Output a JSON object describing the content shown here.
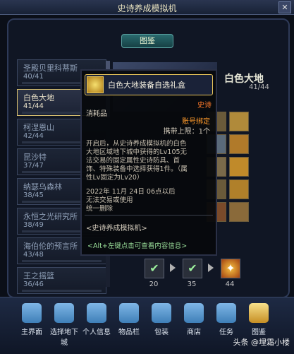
{
  "window": {
    "title": "史诗养成模拟机"
  },
  "tab": {
    "label": "图鉴"
  },
  "list": {
    "items": [
      {
        "name": "圣殿贝里科蒂斯",
        "count": "40/41"
      },
      {
        "name": "白色大地",
        "count": "41/44",
        "selected": true
      },
      {
        "name": "柯涅恩山",
        "count": "42/44"
      },
      {
        "name": "昆沙特",
        "count": "37/47"
      },
      {
        "name": "纳瑟乌森林",
        "count": "38/45"
      },
      {
        "name": "永恒之光研究所",
        "count": "38/49"
      },
      {
        "name": "海伯伦的预言所",
        "count": "43/48"
      },
      {
        "name": "王之摇篮",
        "count": "36/46"
      }
    ]
  },
  "detail": {
    "title": "白色大地",
    "count": "41/44"
  },
  "tooltip": {
    "name": "白色大地装备自选礼盒",
    "grade": "史诗",
    "type": "消耗品",
    "bind": "账号绑定",
    "limit": "携带上限：1个",
    "description": "开启后，从史诗养成模拟机的白色大地区域地下城中获得的Lv105无法交易的固定属性史诗防具、首饰、特殊装备中选择获得1件。（属性Lv固定为Lv20）",
    "expiry": "2022年 11月 24日 06点以后\n无法交易或使用\n统一删除",
    "source": "<史诗养成模拟机>",
    "hint": "<Alt+左键点击可查看内容信息>"
  },
  "progress": {
    "milestones": [
      {
        "value": "20",
        "state": "done"
      },
      {
        "value": "35",
        "state": "done"
      },
      {
        "value": "44",
        "state": "reward"
      }
    ]
  },
  "nav": {
    "items": [
      {
        "label": "主界面",
        "icon": "home-icon"
      },
      {
        "label": "选择地下城",
        "icon": "dungeon-gate-icon"
      },
      {
        "label": "个人信息",
        "icon": "character-icon"
      },
      {
        "label": "物品栏",
        "icon": "inventory-icon"
      },
      {
        "label": "包装",
        "icon": "share-icon"
      },
      {
        "label": "商店",
        "icon": "exchange-icon"
      },
      {
        "label": "任务",
        "icon": "quest-scroll-icon"
      },
      {
        "label": "图鉴",
        "icon": "book-icon",
        "active": true
      }
    ]
  },
  "watermark": "头条 @埋霜小楼",
  "colors": {
    "epic": "#ff7a2a",
    "selected_border": "#d8c070",
    "hint": "#9adf9a"
  }
}
